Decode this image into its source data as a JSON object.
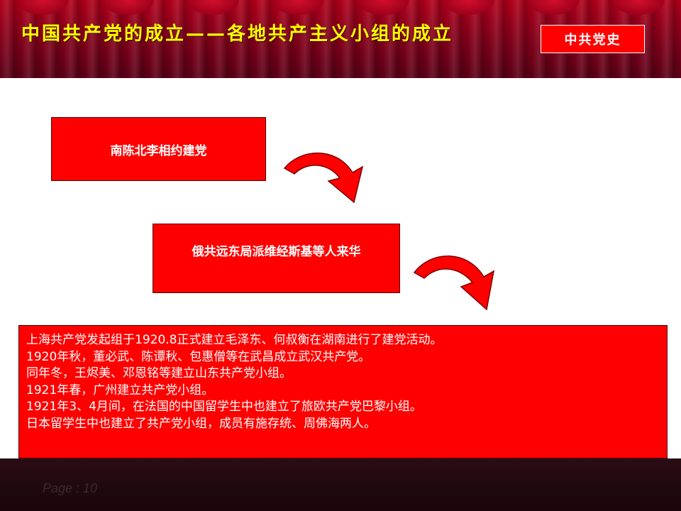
{
  "header": {
    "title": "中国共产党的成立——各地共产主义小组的成立",
    "badge": "中共党史"
  },
  "flow": {
    "step1": "南陈北李相约建党",
    "step2": "俄共远东局派维经斯基等人来华"
  },
  "details": [
    "上海共产党发起组于1920.8正式建立毛泽东、何叔衡在湖南进行了建党活动。",
    "1920年秋，董必武、陈谭秋、包惠僧等在武昌成立武汉共产党。",
    "同年冬，王烬美、邓恩铭等建立山东共产党小组。",
    "1921年春，广州建立共产党小组。",
    "1921年3、4月间，在法国的中国留学生中也建立了旅欧共产党巴黎小组。",
    "日本留学生中也建立了共产党小组，成员有施存统、周佛海两人。"
  ],
  "footer": {
    "page": "Page  :  10"
  },
  "colors": {
    "accent": "#ff0000",
    "title": "#ffff00",
    "curtain": "#a0001c"
  },
  "icons": {
    "arrow1": "curved-arrow-icon",
    "arrow2": "curved-arrow-icon"
  }
}
